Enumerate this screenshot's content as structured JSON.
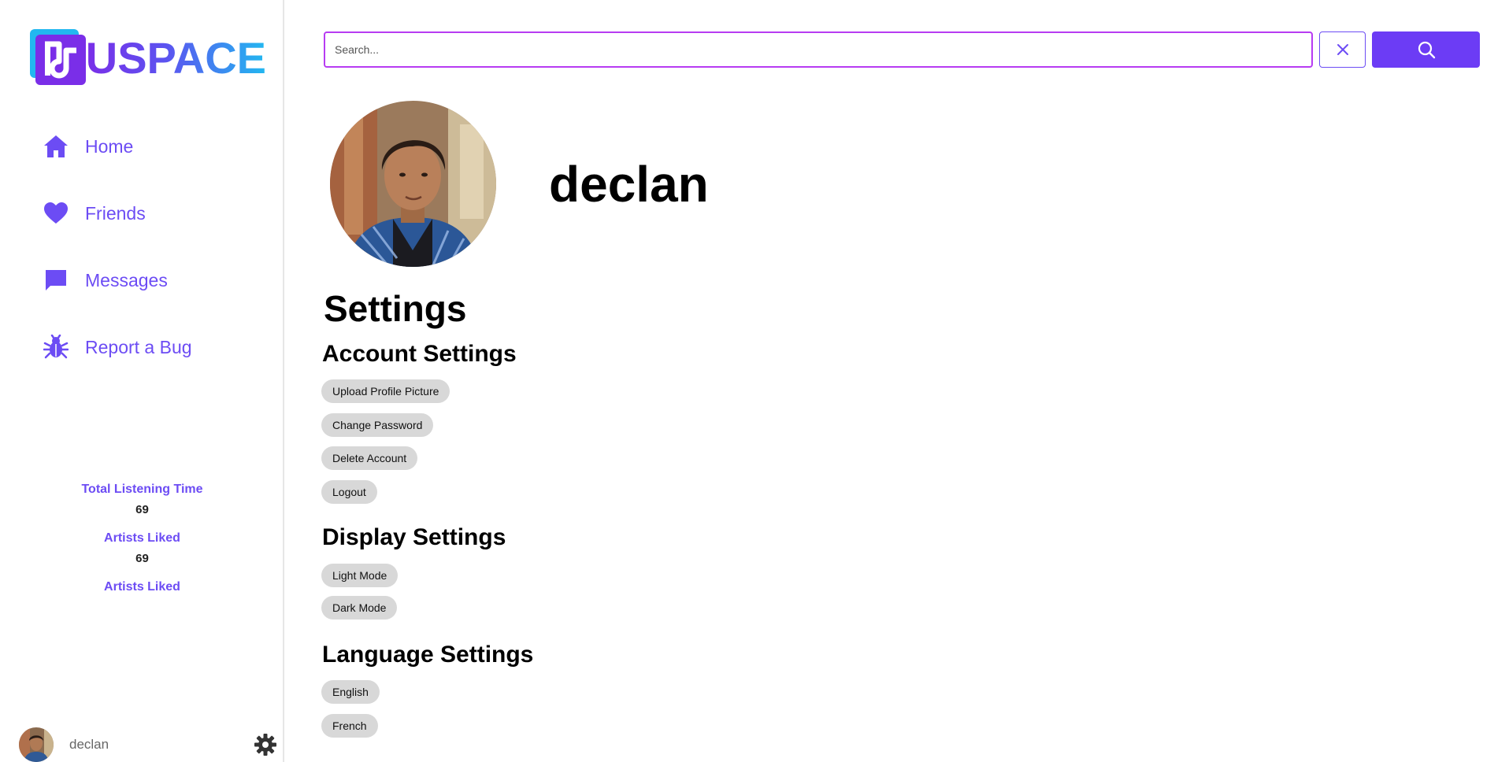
{
  "app": {
    "logo_text": "USPACE"
  },
  "sidebar": {
    "items": [
      {
        "label": "Home",
        "icon": "home-icon"
      },
      {
        "label": "Friends",
        "icon": "heart-icon"
      },
      {
        "label": "Messages",
        "icon": "message-icon"
      },
      {
        "label": "Report a Bug",
        "icon": "bug-icon"
      }
    ],
    "stats": [
      {
        "label": "Total Listening Time",
        "value": "69"
      },
      {
        "label": "Artists Liked",
        "value": "69"
      },
      {
        "label": "Artists Liked"
      }
    ],
    "user": {
      "name": "declan",
      "settings_icon": "gear-icon"
    }
  },
  "search": {
    "placeholder": "Search...",
    "value": ""
  },
  "profile": {
    "name": "declan"
  },
  "settings": {
    "title": "Settings",
    "account": {
      "title": "Account Settings",
      "buttons": [
        "Upload Profile Picture",
        "Change Password",
        "Delete Account",
        "Logout"
      ]
    },
    "display": {
      "title": "Display Settings",
      "buttons": [
        "Light Mode",
        "Dark Mode"
      ]
    },
    "language": {
      "title": "Language Settings",
      "buttons": [
        "English",
        "French"
      ]
    }
  },
  "colors": {
    "accent": "#6c4cf4",
    "search_border": "#b73cf2",
    "search_button": "#6c3cf5",
    "pill": "#d8d8d8"
  }
}
